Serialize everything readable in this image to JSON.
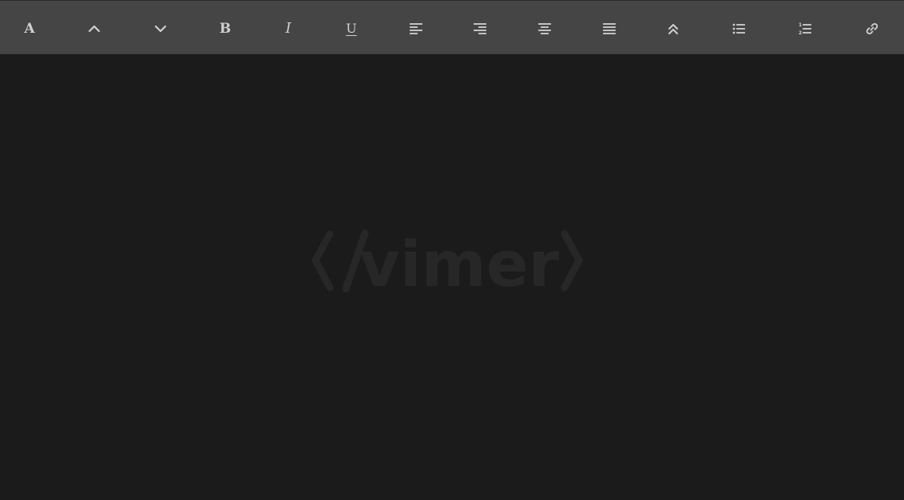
{
  "toolbar": {
    "buttons": [
      {
        "name": "font-style-button",
        "icon": "font-icon",
        "label": "A"
      },
      {
        "name": "move-up-button",
        "icon": "chevron-up-icon"
      },
      {
        "name": "move-down-button",
        "icon": "chevron-down-icon"
      },
      {
        "name": "bold-button",
        "icon": "bold-icon",
        "label": "B"
      },
      {
        "name": "italic-button",
        "icon": "italic-icon",
        "label": "I"
      },
      {
        "name": "underline-button",
        "icon": "underline-icon",
        "label": "U"
      },
      {
        "name": "align-left-button",
        "icon": "align-left-icon"
      },
      {
        "name": "align-right-button",
        "icon": "align-right-icon"
      },
      {
        "name": "align-center-button",
        "icon": "align-center-icon"
      },
      {
        "name": "align-justify-button",
        "icon": "align-justify-icon"
      },
      {
        "name": "collapse-button",
        "icon": "double-chevron-up-icon"
      },
      {
        "name": "bullet-list-button",
        "icon": "bullet-list-icon"
      },
      {
        "name": "numbered-list-button",
        "icon": "numbered-list-icon"
      },
      {
        "name": "link-button",
        "icon": "link-icon"
      }
    ]
  },
  "editor": {
    "content": "",
    "watermark": "</vimer>"
  },
  "colors": {
    "toolbar_bg": "#454545",
    "editor_bg": "#1b1b1b",
    "icon": "#d0d0d0",
    "watermark": "#272727"
  }
}
